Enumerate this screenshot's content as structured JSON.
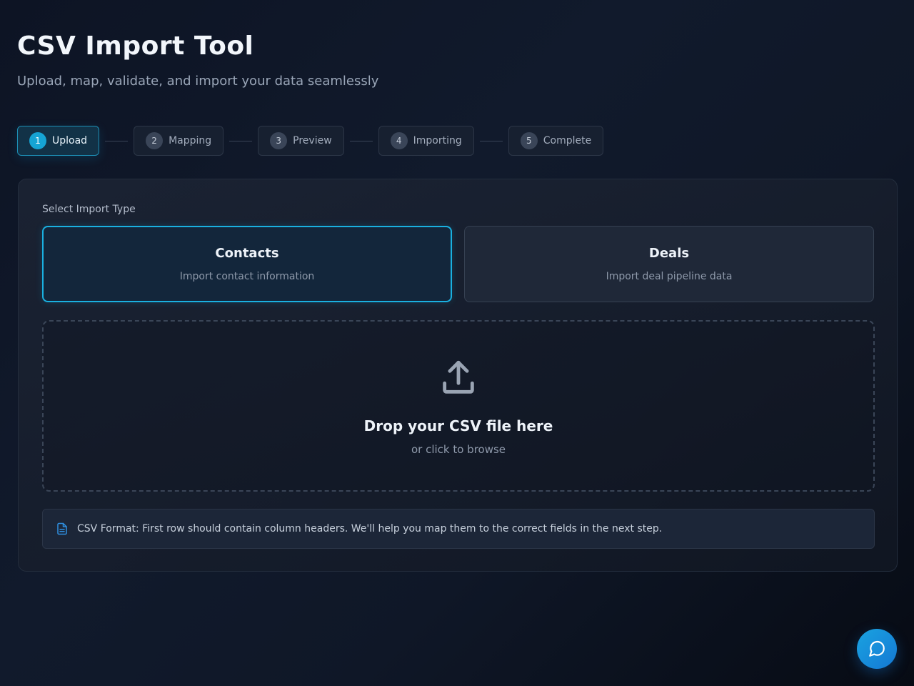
{
  "header": {
    "title": "CSV Import Tool",
    "subtitle": "Upload, map, validate, and import your data seamlessly"
  },
  "steps": [
    {
      "num": "1",
      "label": "Upload",
      "active": true
    },
    {
      "num": "2",
      "label": "Mapping",
      "active": false
    },
    {
      "num": "3",
      "label": "Preview",
      "active": false
    },
    {
      "num": "4",
      "label": "Importing",
      "active": false
    },
    {
      "num": "5",
      "label": "Complete",
      "active": false
    }
  ],
  "import_type": {
    "label": "Select Import Type",
    "options": [
      {
        "title": "Contacts",
        "description": "Import contact information",
        "selected": true
      },
      {
        "title": "Deals",
        "description": "Import deal pipeline data",
        "selected": false
      }
    ]
  },
  "dropzone": {
    "title": "Drop your CSV file here",
    "subtitle": "or click to browse",
    "icon": "upload-icon"
  },
  "info": {
    "text": "CSV Format: First row should contain column headers. We'll help you map them to the correct fields in the next step.",
    "icon": "document-icon"
  },
  "chat": {
    "icon": "chat-bubble-icon"
  },
  "colors": {
    "accent": "#16a4d4",
    "background": "#0d1424"
  }
}
